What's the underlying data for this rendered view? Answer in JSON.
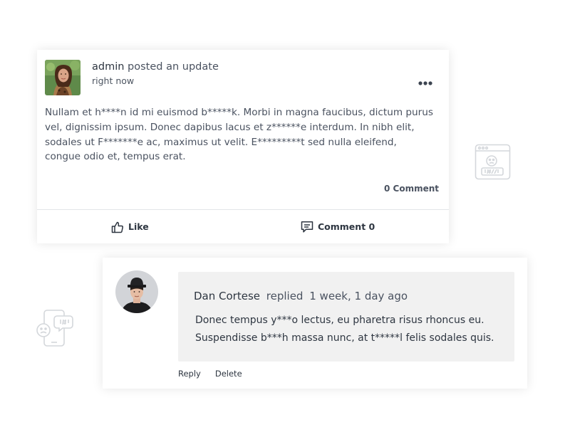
{
  "post": {
    "author": "admin",
    "action": "posted an update",
    "time": "right now",
    "body": "Nullam et h****n id mi euismod b*****k. Morbi in magna faucibus, dictum purus vel, dignissim ipsum. Donec dapibus lacus et z******e interdum. In nibh elit, sodales ut F*******e ac, maximus ut velit. E*********t sed nulla eleifend, congue odio et, tempus erat.",
    "comment_count": "0 Comment",
    "like_label": "Like",
    "comment_label": "Comment 0"
  },
  "reply": {
    "author": "Dan Cortese",
    "action": "replied",
    "time": "1 week, 1 day ago",
    "text_line1": "Donec tempus y***o lectus, eu pharetra risus rhoncus eu.",
    "text_line2": "Suspendisse b***h massa nunc, at t*****l felis sodales quis.",
    "reply_label": "Reply",
    "delete_label": "Delete"
  },
  "icons": {
    "more": "more-horizontal-icon",
    "like": "thumbs-up-icon",
    "comment": "comment-icon",
    "deco_right": "browser-profanity-icon",
    "deco_left": "phone-chat-profanity-icon"
  },
  "colors": {
    "text": "#2e3641",
    "muted_text": "#4a5260",
    "bubble": "#f1f1f1",
    "divider": "#e3e5e8",
    "deco_stroke": "#d4d7db"
  }
}
